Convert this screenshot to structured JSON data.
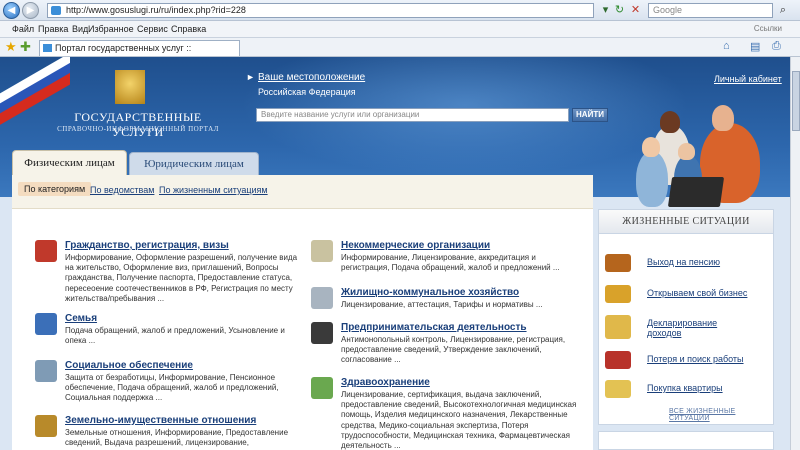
{
  "browser": {
    "url": "http://www.gosuslugi.ru/ru/index.php?rid=228",
    "search_placeholder": "Google",
    "menu": [
      "Файл",
      "Правка",
      "Вид",
      "Избранное",
      "Сервис",
      "Справка"
    ],
    "links_label": "Ссылки",
    "tab_title": "Портал государственных услуг ::"
  },
  "header": {
    "site_title": "ГОСУДАРСТВЕННЫЕ УСЛУГИ",
    "site_subtitle": "СПРАВОЧНО-ИНФОРМАЦИОННЫЙ ПОРТАЛ",
    "location_label": "Ваше местоположение",
    "location_value": "Российская Федерация",
    "cabinet_link": "Личный кабинет",
    "search_placeholder": "Введите название услуги или организации",
    "search_button": "НАЙТИ"
  },
  "tabs": {
    "individuals": "Физическим лицам",
    "legal": "Юридическим лицам"
  },
  "subnav": {
    "by_category": "По категориям",
    "by_department": "По ведомствам",
    "by_situation": "По жизненным ситуациям"
  },
  "categories": [
    {
      "title": "Гражданство, регистрация, визы",
      "desc": "Информирование, Оформление разрешений, получение вида на жительство, Оформление виз, приглашений, Вопросы гражданства, Получение паспорта, Предоставление статуса, пересеоение соотечественников в РФ, Регистрация по месту жительства/пребывания ...",
      "color": "#c0392b"
    },
    {
      "title": "Семья",
      "desc": "Подача обращений, жалоб и предложений, Усыновление и опека ...",
      "color": "#3b6fb8"
    },
    {
      "title": "Социальное обеспечение",
      "desc": "Защита от безработицы, Информирование, Пенсионное обеспечение, Подача обращений, жалоб и предложений, Социальная поддержка ...",
      "color": "#7f9bb5"
    },
    {
      "title": "Земельно-имущественные отношения",
      "desc": "Земельные отношения, Информирование, Предоставление сведений, Выдача разрешений, лицензирование,",
      "color": "#b88a2a"
    },
    {
      "title": "Некоммерческие организации",
      "desc": "Информирование, Лицензирование, аккредитация и регистрация, Подача обращений, жалоб и предложений ...",
      "color": "#c9c2a0"
    },
    {
      "title": "Жилищно-коммунальное хозяйство",
      "desc": "Лицензирование, аттестация, Тарифы и нормативы ...",
      "color": "#a8b4c0"
    },
    {
      "title": "Предпринимательская деятельность",
      "desc": "Антимонопольный контроль, Лицензирование, регистрация, предоставление сведений, Утверждение заключений, согласование ...",
      "color": "#3a3a3a"
    },
    {
      "title": "Здравоохранение",
      "desc": "Лицензирование, сертификация, выдача заключений, предоставление сведений, Высокотехнологичная медицинская помощь, Изделия медицинского назначения, Лекарственные средства, Медико-социальная экспертиза, Потеря трудоспособности, Медицинская техника, Фармацевтическая деятельность ...",
      "color": "#6aa84f"
    }
  ],
  "situations": {
    "heading": "ЖИЗНЕННЫЕ СИТУАЦИИ",
    "items": [
      {
        "label": "Выход на пенсию",
        "color": "#b5651d"
      },
      {
        "label": "Открываем свой бизнес",
        "color": "#d9a22a"
      },
      {
        "label": "Декларирование доходов",
        "color": "#e0b84a"
      },
      {
        "label": "Потеря и поиск работы",
        "color": "#b8322a"
      },
      {
        "label": "Покупка квартиры",
        "color": "#e3c253"
      }
    ],
    "all_link": "ВСЕ ЖИЗНЕННЫЕ СИТУАЦИИ"
  }
}
